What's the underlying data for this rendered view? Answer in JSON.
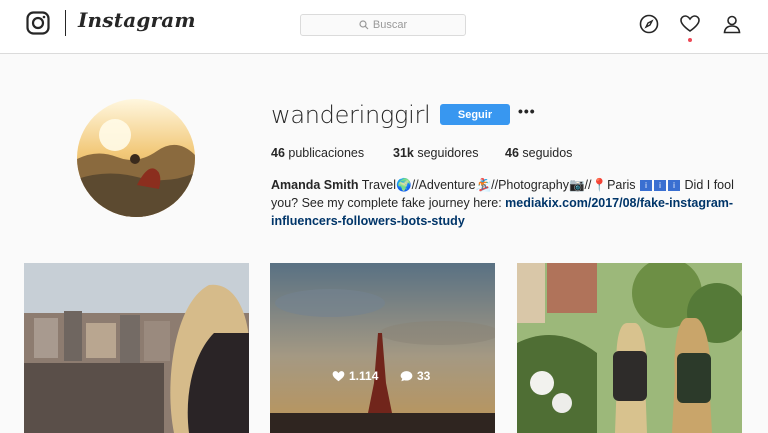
{
  "nav": {
    "brand": "Instagram",
    "search": {
      "placeholder": "Buscar"
    },
    "icons": [
      "instagram-camera-icon",
      "compass-icon",
      "heart-icon",
      "user-icon"
    ],
    "notification_color": "#ed4956"
  },
  "profile": {
    "username": "wanderinggirl",
    "follow_label": "Seguir",
    "more_label": "•••",
    "stats": {
      "posts_count": "46",
      "posts_label": "publicaciones",
      "followers_count": "31k",
      "followers_label": "seguidores",
      "following_count": "46",
      "following_label": "seguidos"
    },
    "bio": {
      "name": "Amanda Smith",
      "text_1": "Travel",
      "text_2": "//Adventure",
      "text_3": "//Photography",
      "text_4": "//",
      "text_5": "Paris",
      "text_6": "Did I fool you? See my complete fake journey here:",
      "link": "mediakix.com/2017/08/fake-instagram-influencers-followers-bots-study"
    }
  },
  "grid": {
    "post_2": {
      "likes": "1.114",
      "comments": "33"
    }
  },
  "colors": {
    "accent": "#3897f0",
    "link": "#003569",
    "border": "#dbdbdb"
  }
}
